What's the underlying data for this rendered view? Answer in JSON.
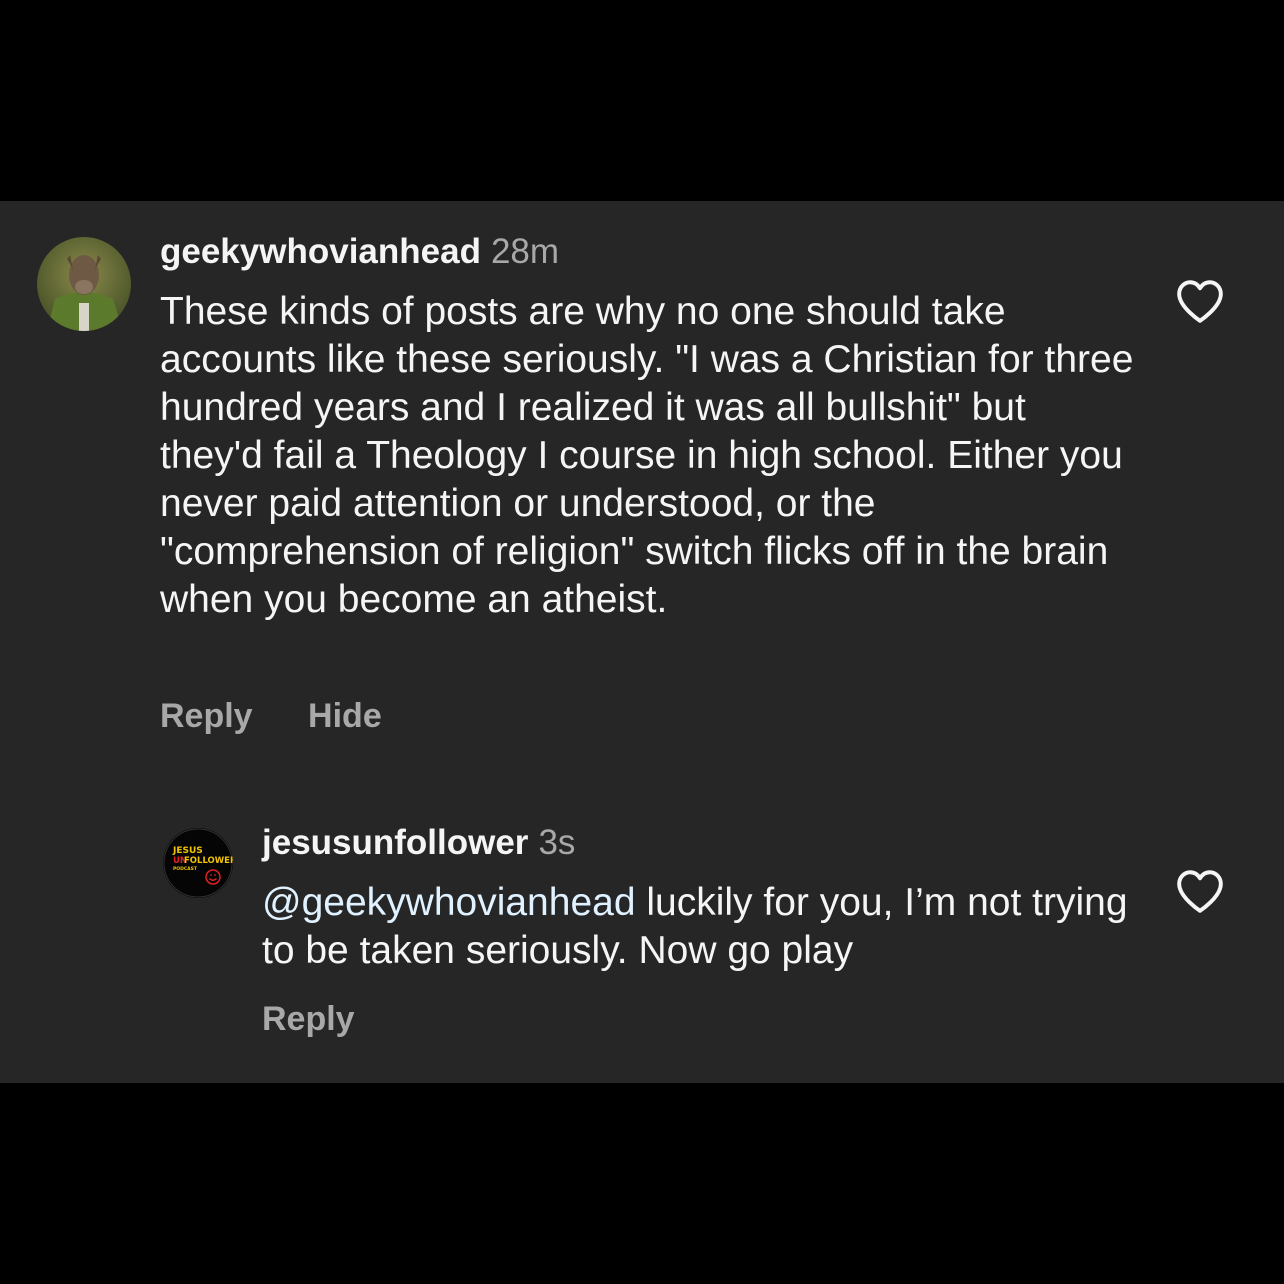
{
  "comments": [
    {
      "username": "geekywhovianhead",
      "time": "28m",
      "text": "These kinds of posts are why no one should take accounts like these seriously. \"I was a Christian for three hundred years and I realized it was all bullshit\" but they'd fail a Theology I course in high school. Either you never paid attention or understood, or the \"comprehension of religion\" switch flicks off in the brain when you become an atheist.",
      "reply_label": "Reply",
      "hide_label": "Hide",
      "like_icon": "heart-outline-icon"
    },
    {
      "username": "jesusunfollower",
      "time": "3s",
      "mention": "@geekywhovianhead",
      "text": " luckily for you, I’m not trying to be taken seriously. Now go play",
      "reply_label": "Reply",
      "like_icon": "heart-outline-icon",
      "avatar_logo": {
        "line1": "JESUS",
        "line2_accent": "UN",
        "line2": "FOLLOWER",
        "line3": "PODCAST"
      }
    }
  ],
  "colors": {
    "background": "#000000",
    "panel": "#262626",
    "text": "#f5f5f5",
    "muted": "#a8a8a8",
    "mention": "#e0f1ff",
    "logo_red": "#e02020",
    "logo_yellow": "#f2c400"
  }
}
